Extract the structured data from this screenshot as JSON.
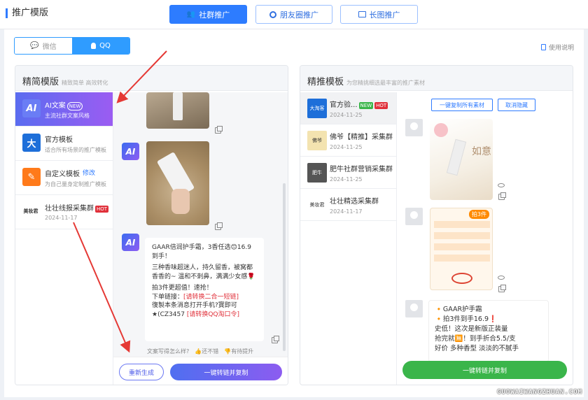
{
  "header": {
    "title": "推广模版",
    "tabs": [
      {
        "label": "社群推广",
        "active": true
      },
      {
        "label": "朋友圈推广",
        "active": false
      },
      {
        "label": "长图推广",
        "active": false
      }
    ]
  },
  "platform_toggle": {
    "wechat": "微信",
    "qq": "QQ",
    "selected": "QQ"
  },
  "help_link": "使用说明",
  "left_panel": {
    "title": "精简模版",
    "subtitle": "精致简单 高效转化",
    "templates": [
      {
        "icon": "AI",
        "name": "AI文案",
        "badge": "NEW",
        "desc": "主流社群文案风格",
        "active": true
      },
      {
        "icon": "大",
        "name": "官方模板",
        "desc": "适合所有场景的推广模板"
      },
      {
        "icon": "✎",
        "name": "自定义模板",
        "action": "修改",
        "desc": "为自己量身定制推广模板"
      },
      {
        "icon": "美妆君",
        "name": "壮壮线报采集群",
        "badge": "HOT",
        "date": "2024-11-17"
      }
    ],
    "message": {
      "line1": "GAAR倍润护手霜，3香任选😊16.9到手！",
      "line2": "三种香味超迷人，持久留香，被窝都香香的~ 温和不刺鼻，满满少女感🌹",
      "line3": "拍3件更超值！速抢！",
      "line4_prefix": "下单链接：",
      "line4_link": "[请转换二合一短链]",
      "line5": "復製本条消息打开手机?寳即可★(CZ3457",
      "line5_link": "[请转换QQ淘口令]"
    },
    "feedback": {
      "question": "文案写得怎么样?",
      "good": "还不错",
      "improve": "有待提升"
    },
    "regen_button": "重新生成",
    "convert_button": "一键转链并复制"
  },
  "right_panel": {
    "title": "精推模板",
    "subtitle": "为您精挑细选最丰富的推广素材",
    "groups": [
      {
        "avatar": "大淘客",
        "name": "官方验...",
        "badges": [
          "NEW",
          "HOT"
        ],
        "date": "2024-11-25",
        "active": true
      },
      {
        "avatar": "佛爷",
        "name": "佛爷【精推】采集群",
        "date": "2024-11-25"
      },
      {
        "avatar": "肥牛",
        "name": "肥牛社群营销采集群",
        "date": "2024-11-25"
      },
      {
        "avatar": "美妆君",
        "name": "壮壮精选采集群",
        "date": "2024-11-17"
      }
    ],
    "copy_all_button": "一键复制所有素材",
    "hide_button": "取消隐藏",
    "image_text": "如意",
    "promo_tag": "拍3件",
    "message": {
      "line1": "🔸GAAR护手霜",
      "line2": "🔸拍3件到手16.9❗",
      "line3": "史低！这次是新版正装量",
      "line4": "抢完就🈚！到手折合5.5/支",
      "line5": "好价 多种香型 淡淡的不腻手"
    },
    "convert_button": "一键转链并复制"
  },
  "watermark": "GUOWAIWANGZHUAN.COM"
}
